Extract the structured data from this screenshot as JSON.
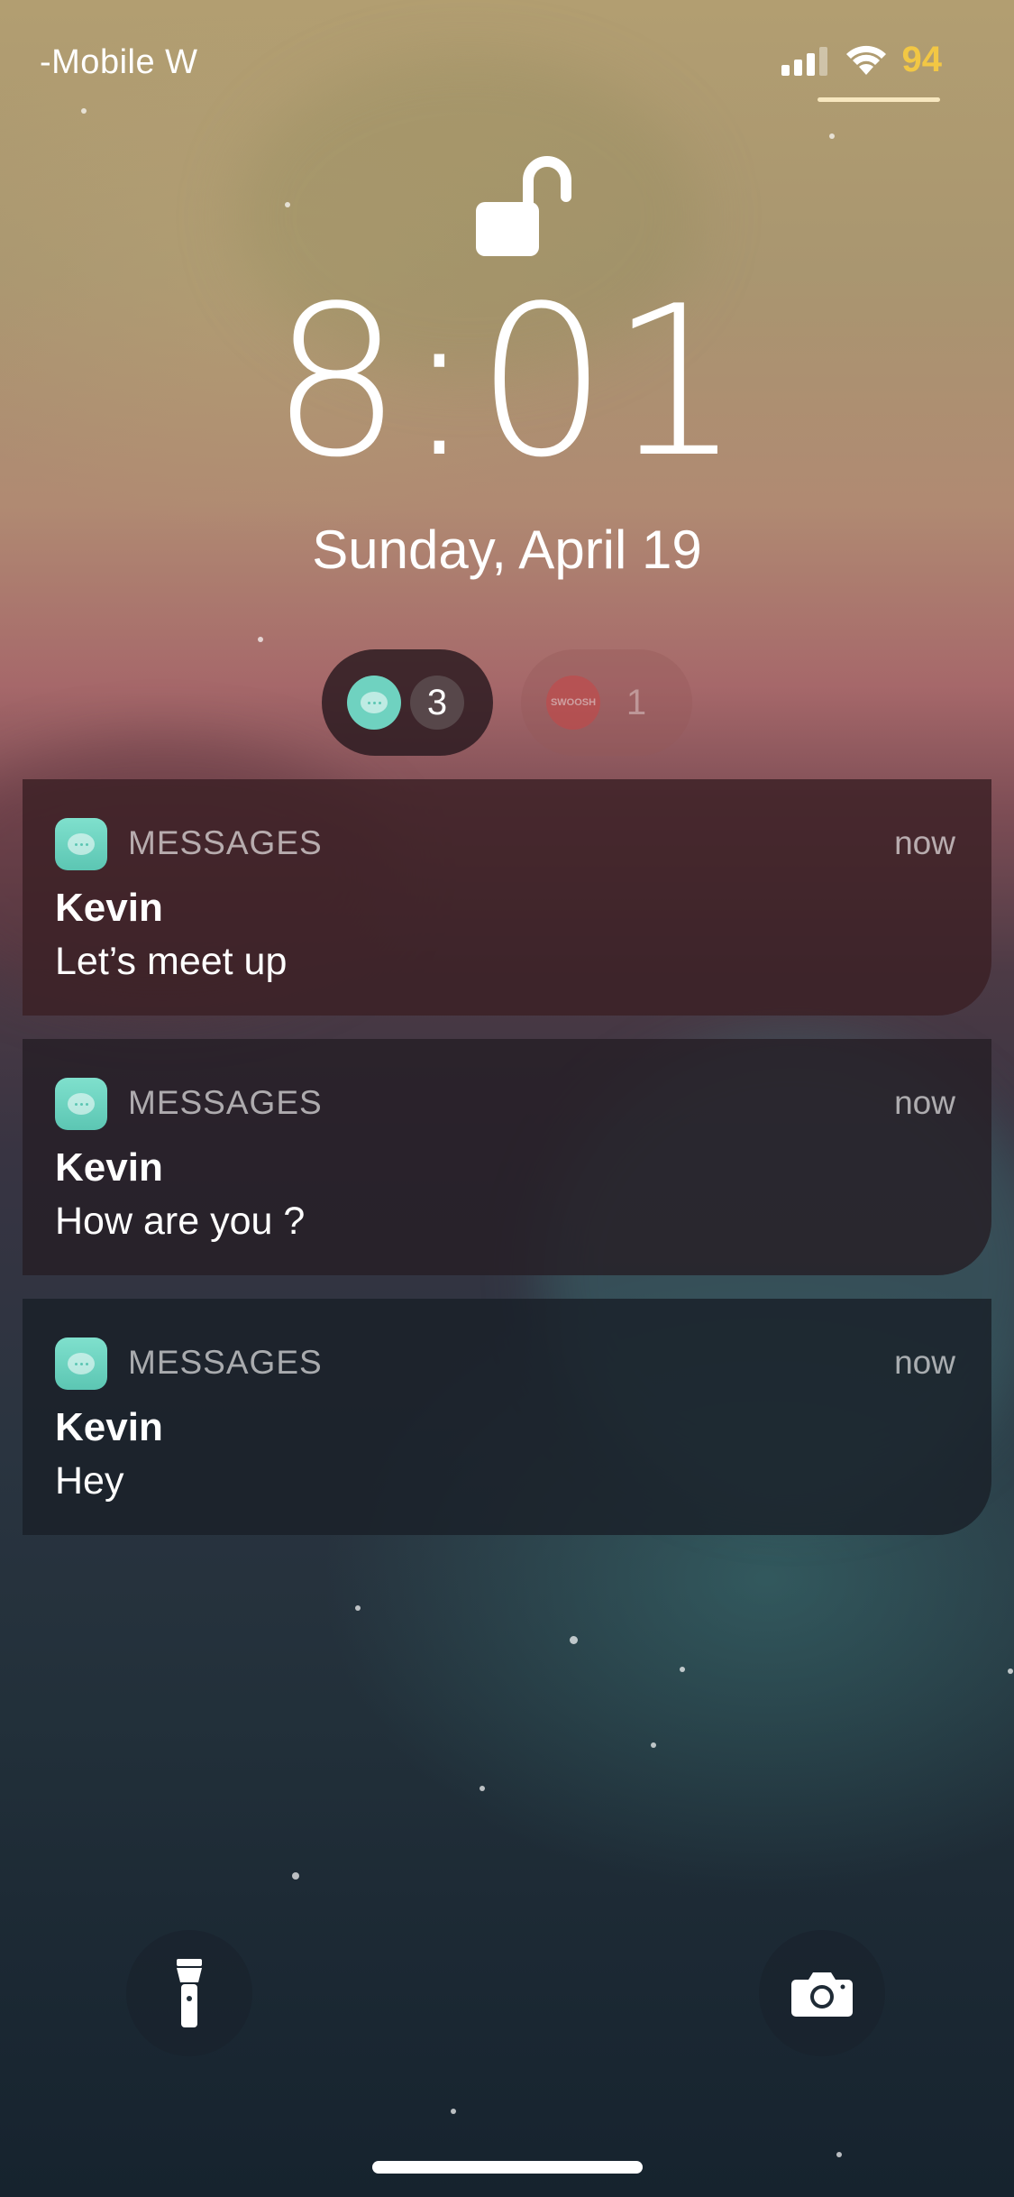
{
  "status_bar": {
    "carrier": "-Mobile W",
    "battery_percent": "94",
    "battery_color": "#f2c744"
  },
  "lock_screen": {
    "lock_state_icon": "unlocked-padlock-icon",
    "time": "8:01",
    "date": "Sunday, April 19"
  },
  "notification_groups": [
    {
      "app_icon": "messages-icon",
      "count": "3",
      "active": true
    },
    {
      "app_icon": "nike-icon",
      "icon_text": "SWOOSH",
      "count": "1",
      "active": false
    }
  ],
  "notifications": [
    {
      "app": "MESSAGES",
      "time": "now",
      "sender": "Kevin",
      "message": "Let’s meet up",
      "tint": "rgba(58,32,36,0.82)"
    },
    {
      "app": "MESSAGES",
      "time": "now",
      "sender": "Kevin",
      "message": "How are you ?",
      "tint": "rgba(38,30,38,0.82)"
    },
    {
      "app": "MESSAGES",
      "time": "now",
      "sender": "Kevin",
      "message": "Hey",
      "tint": "rgba(26,32,40,0.82)"
    }
  ],
  "quick_actions": {
    "left": "flashlight-icon",
    "right": "camera-icon"
  }
}
